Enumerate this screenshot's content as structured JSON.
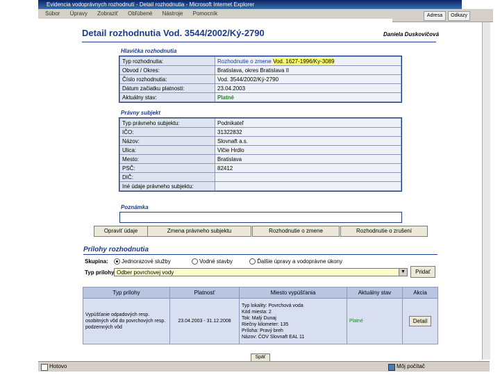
{
  "window": {
    "title": "Evidencia vodoprávnych rozhodnutí - Detail rozhodnutia - Microsoft Internet Explorer",
    "menu": [
      "Súbor",
      "Úpravy",
      "Zobraziť",
      "Obľúbené",
      "Nástroje",
      "Pomocník"
    ],
    "top_buttons": [
      "Adresa",
      "Odkazy"
    ],
    "status_left": "Hotovo",
    "status_right": "Môj počítač"
  },
  "page": {
    "title": "Detail rozhodnutia Vod. 3544/2002/Ký-2790",
    "user": "Daniela Duskovičová"
  },
  "header_section": {
    "title": "Hlavička rozhodnutia",
    "rows": [
      {
        "label": "Typ rozhodnutia:",
        "value": "Rozhodnutie o zmene",
        "extra": "Vod. 1627-1996/Ky-3089"
      },
      {
        "label": "Obvod / Okres:",
        "value": "Bratislava, okres Bratislava II"
      },
      {
        "label": "Číslo rozhodnutia:",
        "value": "Vod. 3544/2002/Ký-2790"
      },
      {
        "label": "Dátum začiatku platnosti:",
        "value": "23.04.2003"
      },
      {
        "label": "Aktuálny stav:",
        "value": "Platné"
      }
    ]
  },
  "subject_section": {
    "title": "Právny subjekt",
    "rows": [
      {
        "label": "Typ právneho subjektu:",
        "value": "Podnikateľ"
      },
      {
        "label": "IČO:",
        "value": "31322832"
      },
      {
        "label": "Názov:",
        "value": "Slovnaft a.s."
      },
      {
        "label": "Ulica:",
        "value": "Vlčie Hrdlo"
      },
      {
        "label": "Mesto:",
        "value": "Bratislava"
      },
      {
        "label": "PSČ:",
        "value": "82412"
      },
      {
        "label": "DIČ:",
        "value": ""
      },
      {
        "label": "Iné údaje právneho subjektu:",
        "value": ""
      }
    ]
  },
  "notes_section": {
    "title": "Poznámka"
  },
  "action_buttons": [
    "Opraviť údaje",
    "Zmena právneho subjektu",
    "Rozhodnutie o zmene",
    "Rozhodnutie o zrušení"
  ],
  "attachments": {
    "title": "Prílohy rozhodnutia",
    "group_label": "Skupina:",
    "radios": [
      {
        "label": "Jednorazové služby",
        "selected": true
      },
      {
        "label": "Vodné stavby",
        "selected": false
      },
      {
        "label": "Ďalšie úpravy a vodoprávne úkony",
        "selected": false
      }
    ],
    "type_label": "Typ prílohy:",
    "type_value": "Odber povrchovej vody",
    "add_button": "Pridať",
    "columns": [
      "Typ prílohy",
      "Platnosť",
      "Miesto vypúšťania",
      "Aktuálny stav",
      "Akcia"
    ],
    "rows": [
      {
        "type": "Vypúšťanie odpadových resp. osobitných vôd do povrchových resp. podzemných vôd",
        "validity": "23.04.2003 - 31.12.2008",
        "location": [
          "Typ lokality: Povrchová voda",
          "Kód miesta: 2",
          "Tok: Malý Dunaj",
          "Riečny kilometer: 135",
          "Príloha: Pravý breh",
          "Názov: ČOV Slovnaft EAL 11"
        ],
        "status": "Platné",
        "action": "Detail"
      }
    ]
  },
  "back_button": "Späť"
}
